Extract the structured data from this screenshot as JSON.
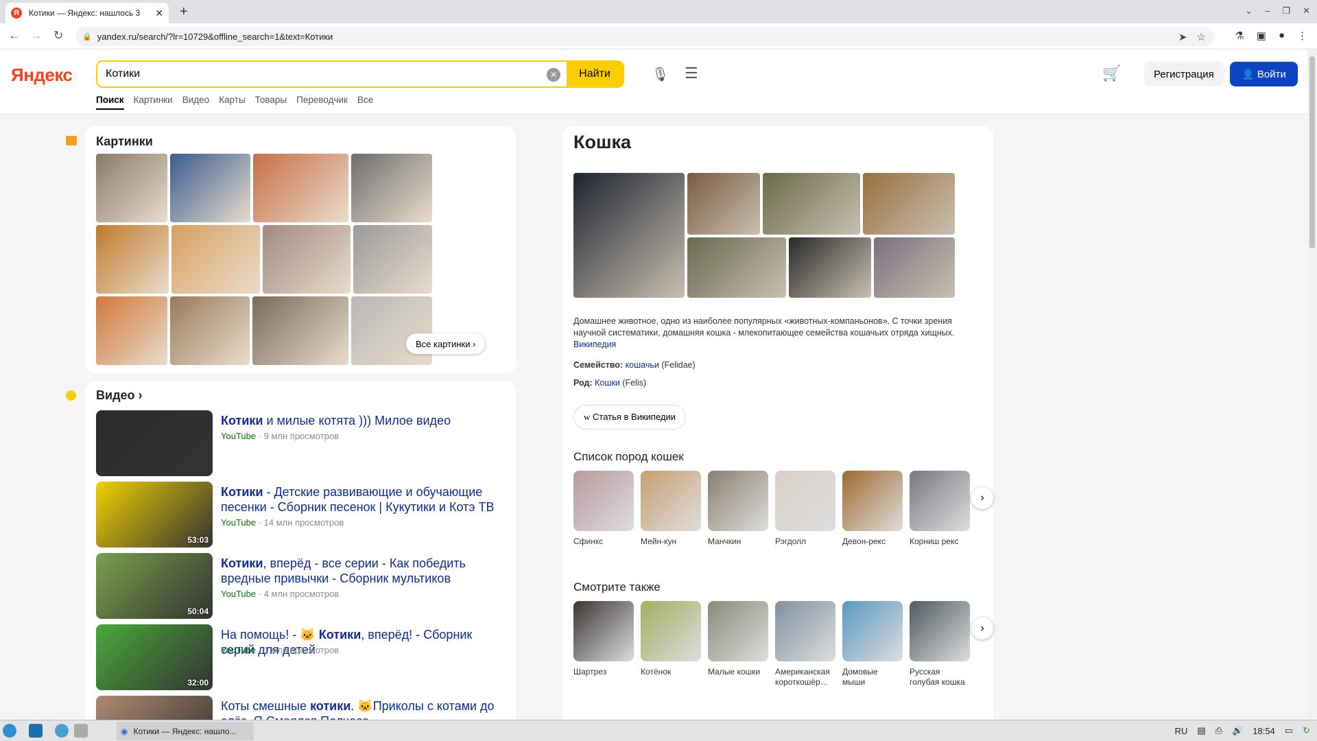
{
  "browser": {
    "tab_title": "Котики — Яндекс: нашлось 3",
    "tab_favicon": "Я",
    "url": "yandex.ru/search/?lr=10729&offline_search=1&text=Котики",
    "new_tab": "+"
  },
  "header": {
    "logo": "Яндекс",
    "search_value": "Котики",
    "find_label": "Найти",
    "register_label": "Регистрация",
    "login_label": "Войти"
  },
  "service_tabs": [
    "Поиск",
    "Картинки",
    "Видео",
    "Карты",
    "Товары",
    "Переводчик",
    "Все"
  ],
  "images_section": {
    "title": "Картинки",
    "all_label": "Все картинки",
    "thumb_colors": [
      [
        "#8a7a6a",
        "#3b5c8e",
        "#c86f46",
        "#6e6e6e"
      ],
      [
        "#c27a2a",
        "#d9a060",
        "#a08a80",
        "#9a9a9a"
      ],
      [
        "#d0783a",
        "#9a7a5a",
        "#7a6a5a",
        "#b8b8b8"
      ]
    ]
  },
  "video_section": {
    "title": "Видео",
    "items": [
      {
        "bold": "Котики",
        "rest": " и милые котята ))) Милое видео",
        "source": "YouTube",
        "views": " · 9 млн просмотров",
        "duration": "",
        "color": "#2c2c2c"
      },
      {
        "bold": "Котики",
        "rest": " - Детские развивающие и обучающие песенки - Сборник песенок | Кукутики и Котэ ТВ",
        "source": "YouTube",
        "views": " · 14 млн просмотров",
        "duration": "53:03",
        "color": "#f0d000"
      },
      {
        "bold": "Котики",
        "rest": ", вперёд - все серии - Как победить вредные привычки - Сборник мультиков",
        "source": "YouTube",
        "views": " · 4 млн просмотров",
        "duration": "50:04",
        "color": "#7aa04a"
      },
      {
        "pre": "На помощь! - 🐱 ",
        "bold": "Котики",
        "rest": ", вперёд! - Сборник серий для детей",
        "source": "YouTube",
        "views": " · 1 млн просмотров",
        "duration": "32:00",
        "color": "#4aa83a"
      },
      {
        "pre": "Коты смешные ",
        "bold": "котики",
        "rest": ". 🐱Приколы с котами до слёз. Я Смеялся Полчаса",
        "source": "",
        "views": "",
        "duration": "",
        "color": "#b08a70"
      }
    ]
  },
  "knowledge": {
    "title": "Кошка",
    "gallery_colors": [
      "#1e2330",
      "#7a5c40",
      "#6a6a4a",
      "#9a7040",
      "#6a6a50",
      "#2a2a2a",
      "#7a7080"
    ],
    "description": "Домашнее животное, одно из наиболее популярных «животных-компаньонов». С точки зрения научной систематики, домашняя кошка - млекопитающее семейства кошачьих отряда хищных.",
    "desc_link": "Википедия",
    "family_label": "Семейство:",
    "family_link": "кошачьи",
    "family_latin": "(Felidae)",
    "genus_label": "Род:",
    "genus_link": "Кошки",
    "genus_latin": "(Felis)",
    "wiki_button": "Статья в Википедии",
    "breeds_title": "Список пород кошек",
    "breeds": [
      {
        "label": "Сфинкс",
        "color": "#b89aa0"
      },
      {
        "label": "Мейн-кун",
        "color": "#c8a070"
      },
      {
        "label": "Манчкин",
        "color": "#8a8070"
      },
      {
        "label": "Рэгдолл",
        "color": "#d8d0c8"
      },
      {
        "label": "Девон-рекс",
        "color": "#a06a30"
      },
      {
        "label": "Корниш рекс",
        "color": "#7a7880"
      }
    ],
    "see_also_title": "Смотрите также",
    "see_also": [
      {
        "label": "Шартрез",
        "color": "#3a3634"
      },
      {
        "label": "Котёнок",
        "color": "#a0b060"
      },
      {
        "label": "Малые кошки",
        "color": "#8a8a7a"
      },
      {
        "label": "Американская короткошёр…",
        "color": "#8090a0"
      },
      {
        "label": "Домовые мыши",
        "color": "#5a98c0"
      },
      {
        "label": "Русская голубая кошка",
        "color": "#505a60"
      }
    ]
  },
  "taskbar": {
    "app_label": "Котики — Яндекс: нашло...",
    "lang": "RU",
    "time": "18:54"
  },
  "colors": {
    "accent_yellow": "#ffcc00",
    "login_blue": "#0b45c4",
    "link_blue": "#0b2e96",
    "logo_red": "#fc3f1d"
  }
}
